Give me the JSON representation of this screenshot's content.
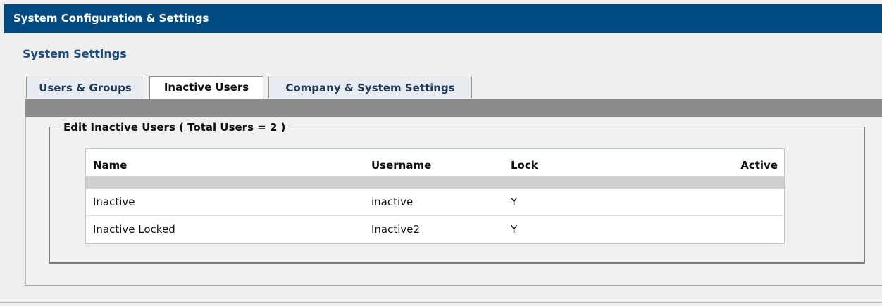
{
  "window": {
    "title": "System Configuration & Settings"
  },
  "page": {
    "heading": "System Settings"
  },
  "tabs": [
    {
      "label": "Users & Groups",
      "active": false
    },
    {
      "label": "Inactive Users",
      "active": true
    },
    {
      "label": "Company & System Settings",
      "active": false
    }
  ],
  "section": {
    "legend": "Edit Inactive Users ( Total Users = 2 )"
  },
  "table": {
    "columns": [
      "Name",
      "Username",
      "Lock",
      "Active"
    ],
    "rows": [
      {
        "name": "Inactive",
        "username": "inactive",
        "lock": "Y",
        "active": ""
      },
      {
        "name": "Inactive Locked",
        "username": "Inactive2",
        "lock": "Y",
        "active": ""
      }
    ]
  },
  "colors": {
    "titlebar": "#004a80",
    "heading": "#1c4e80",
    "tabstrip_bar": "#8b8b8b",
    "table_spacer": "#cfcfcf"
  }
}
